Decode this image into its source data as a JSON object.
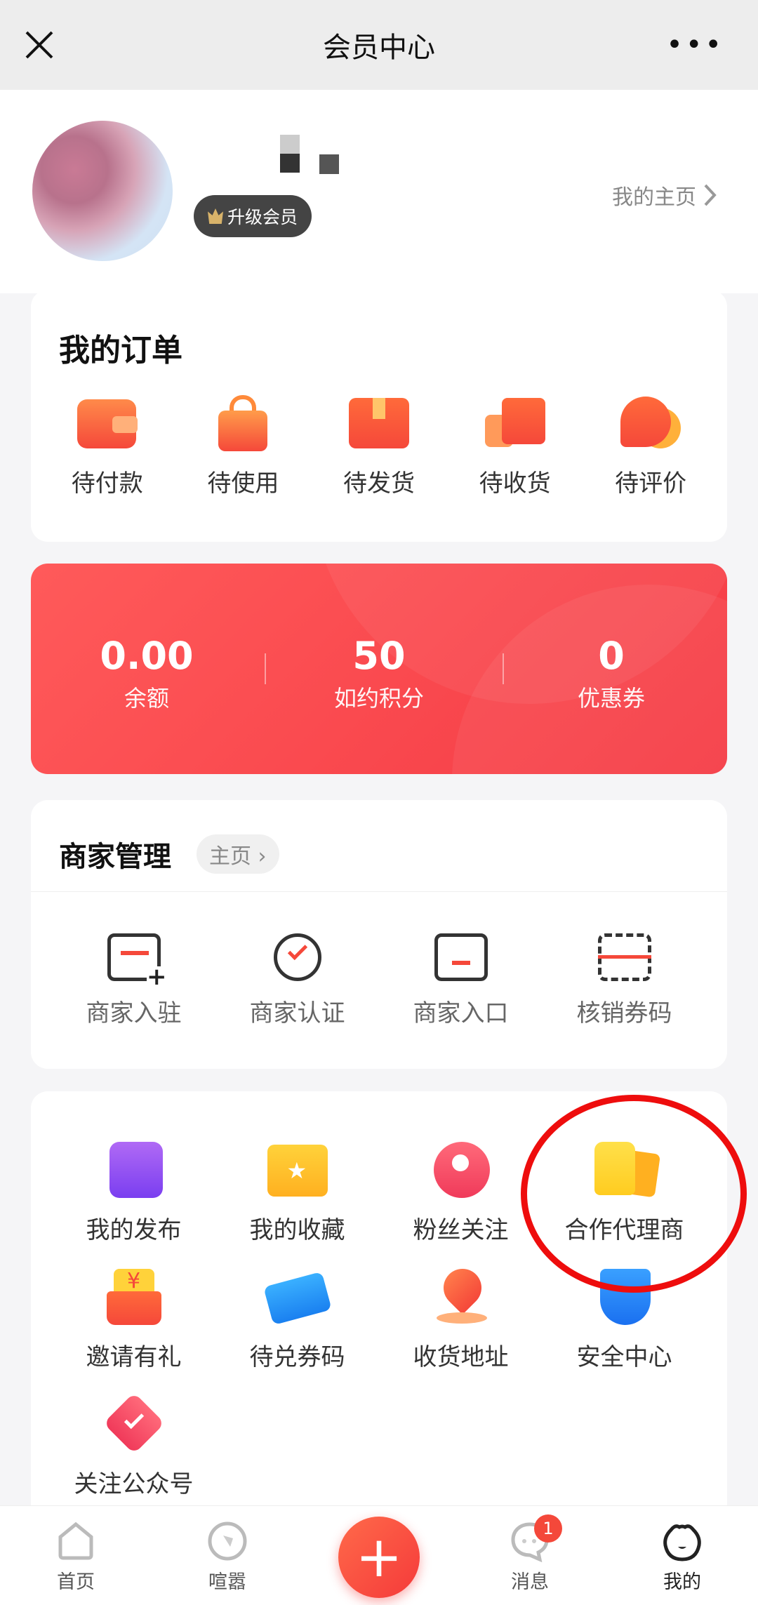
{
  "header": {
    "title": "会员中心",
    "close_icon": "close-icon",
    "more_icon": "more-dots-icon"
  },
  "profile": {
    "badge": "升级会员",
    "homepage_link": "我的主页"
  },
  "orders": {
    "title": "我的订单",
    "items": [
      {
        "label": "待付款",
        "icon": "wallet-icon"
      },
      {
        "label": "待使用",
        "icon": "shopping-bag-icon"
      },
      {
        "label": "待发货",
        "icon": "package-icon"
      },
      {
        "label": "待收货",
        "icon": "truck-icon"
      },
      {
        "label": "待评价",
        "icon": "comment-icon"
      }
    ]
  },
  "wallet": {
    "stats": [
      {
        "value": "0.00",
        "label": "余额"
      },
      {
        "value": "50",
        "label": "如约积分"
      },
      {
        "value": "0",
        "label": "优惠券"
      }
    ],
    "color": "#f5454c"
  },
  "merchant": {
    "title": "商家管理",
    "home_pill": "主页",
    "items": [
      {
        "label": "商家入驻",
        "icon": "store-add-icon"
      },
      {
        "label": "商家认证",
        "icon": "verified-badge-icon"
      },
      {
        "label": "商家入口",
        "icon": "store-icon"
      },
      {
        "label": "核销券码",
        "icon": "scan-icon"
      }
    ]
  },
  "tools": {
    "items": [
      {
        "label": "我的发布",
        "icon": "edit-icon"
      },
      {
        "label": "我的收藏",
        "icon": "star-folder-icon"
      },
      {
        "label": "粉丝关注",
        "icon": "fans-icon"
      },
      {
        "label": "合作代理商",
        "icon": "thumbs-up-icon"
      },
      {
        "label": "邀请有礼",
        "icon": "red-envelope-icon"
      },
      {
        "label": "待兑券码",
        "icon": "ticket-icon"
      },
      {
        "label": "收货地址",
        "icon": "location-icon"
      },
      {
        "label": "安全中心",
        "icon": "shield-icon"
      },
      {
        "label": "关注公众号",
        "icon": "check-badge-icon"
      }
    ]
  },
  "nav": {
    "items": [
      {
        "label": "首页"
      },
      {
        "label": "喧嚣"
      },
      {
        "label": "消息",
        "badge": "1"
      },
      {
        "label": "我的"
      }
    ],
    "plus": "+"
  }
}
